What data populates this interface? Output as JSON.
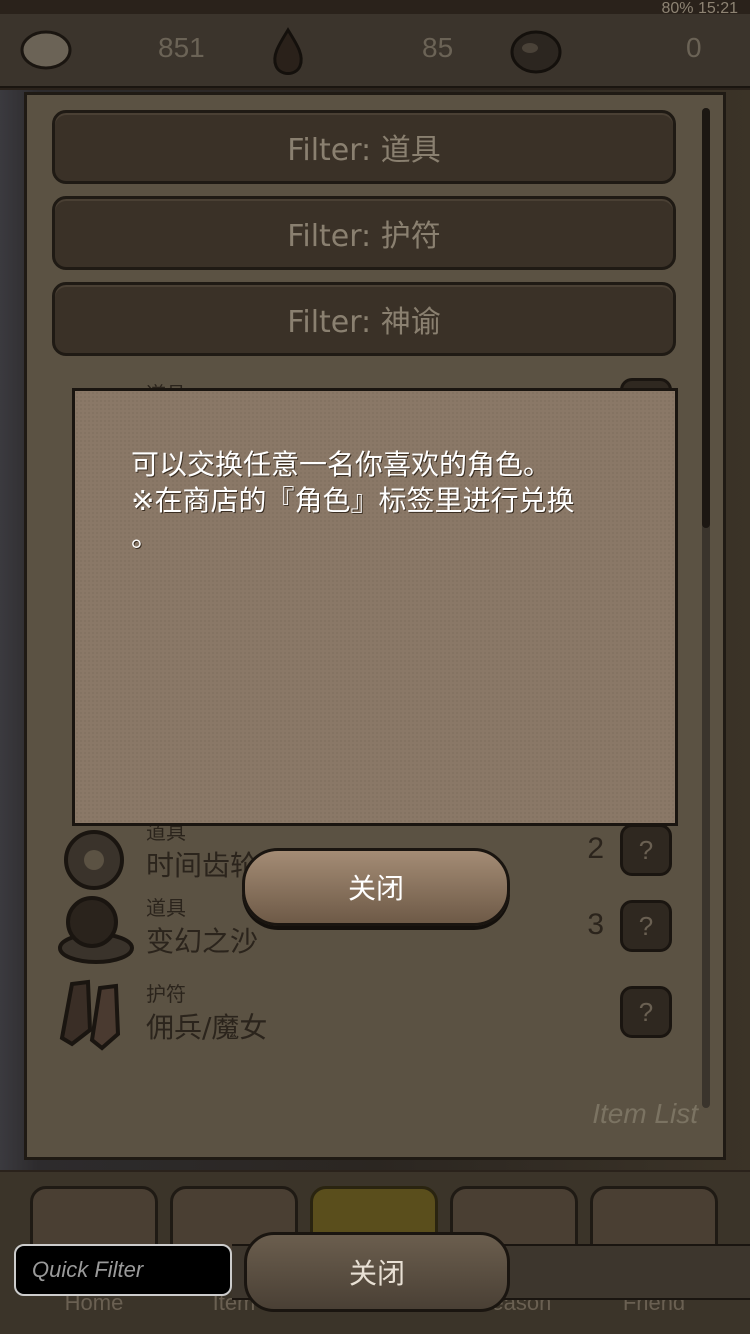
{
  "status": {
    "battery": "80%",
    "time": "15:21"
  },
  "currencies": [
    {
      "icon": "stone-icon",
      "value": "851"
    },
    {
      "icon": "drop-icon",
      "value": "85"
    },
    {
      "icon": "bean-icon",
      "value": "0"
    }
  ],
  "filters": [
    "Filter: 道具",
    "Filter: 护符",
    "Filter: 神谕"
  ],
  "dialog": {
    "text": "可以交换任意一名你喜欢的角色。\n※在商店的『角色』标签里进行兑换\n。",
    "close_label": "关闭"
  },
  "items": [
    {
      "type": "道具",
      "name": "时间齿轮",
      "qty": "2",
      "help": "?",
      "icon": "gear-icon"
    },
    {
      "type": "道具",
      "name": "变幻之沙",
      "qty": "3",
      "help": "?",
      "icon": "hourglass-icon"
    },
    {
      "type": "护符",
      "name": "佣兵/魔女",
      "qty": "",
      "help": "?",
      "icon": "boots-icon"
    }
  ],
  "partial_top_item": {
    "type": "道具",
    "help": "?"
  },
  "panel_caption": "Item List",
  "quick_filter": {
    "placeholder": "Quick Filter"
  },
  "bottom_close_label": "关闭",
  "tabs": [
    {
      "icon": "home-icon",
      "label": "Home"
    },
    {
      "icon": "item-icon",
      "label": "Item"
    },
    {
      "icon": "gacha-icon",
      "label": ""
    },
    {
      "icon": "season-icon",
      "label": "Season"
    },
    {
      "icon": "friend-icon",
      "label": "Friend"
    }
  ]
}
